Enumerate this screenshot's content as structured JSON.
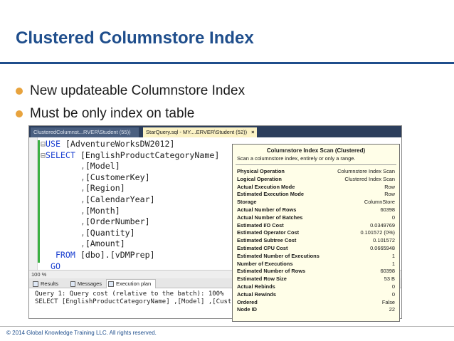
{
  "slide": {
    "title": "Clustered Columnstore Index",
    "bullets": [
      "New updateable Columnstore Index",
      "Must be only index on table"
    ],
    "footer": "© 2014 Global Knowledge Training LLC. All rights reserved."
  },
  "ssms": {
    "tabs": [
      "ClusteredColumnst...RVER\\Student (55))",
      "StarQuery.sql - MY....ERVER\\Student (52))"
    ],
    "tab_close": "×",
    "code": {
      "line1_kw": "USE",
      "line1_rest": " [AdventureWorksDW2012]",
      "line2_kw": "SELECT",
      "line2_rest": " [EnglishProductCategoryName]",
      "columns": [
        "[Model]",
        "[CustomerKey]",
        "[Region]",
        "[CalendarYear]",
        "[Month]",
        "[OrderNumber]",
        "[Quantity]",
        "[Amount]"
      ],
      "from_kw": "FROM",
      "from_rest": " [dbo].[vDMPrep]",
      "go_kw": "GO"
    },
    "zoom": "100 %",
    "result_tabs": [
      "Results",
      "Messages",
      "Execution plan"
    ],
    "query_lines": [
      "Query 1: Query cost (relative to the batch): 100%",
      "SELECT [EnglishProductCategoryName] ,[Model] ,[Custo"
    ]
  },
  "tooltip": {
    "title": "Columnstore Index Scan (Clustered)",
    "description": "Scan a columnstore index, entirely or only a range.",
    "rows": [
      {
        "k": "Physical Operation",
        "v": "Columnstore Index Scan"
      },
      {
        "k": "Logical Operation",
        "v": "Clustered Index Scan"
      },
      {
        "k": "Actual Execution Mode",
        "v": "Row"
      },
      {
        "k": "Estimated Execution Mode",
        "v": "Row"
      },
      {
        "k": "Storage",
        "v": "ColumnStore"
      },
      {
        "k": "Actual Number of Rows",
        "v": "60398"
      },
      {
        "k": "Actual Number of Batches",
        "v": "0"
      },
      {
        "k": "Estimated I/O Cost",
        "v": "0.0349769"
      },
      {
        "k": "Estimated Operator Cost",
        "v": "0.101572 (0%)"
      },
      {
        "k": "Estimated Subtree Cost",
        "v": "0.101572"
      },
      {
        "k": "Estimated CPU Cost",
        "v": "0.0665948"
      },
      {
        "k": "Estimated Number of Executions",
        "v": "1"
      },
      {
        "k": "Number of Executions",
        "v": "1"
      },
      {
        "k": "Estimated Number of Rows",
        "v": "60398"
      },
      {
        "k": "Estimated Row Size",
        "v": "53 B"
      },
      {
        "k": "Actual Rebinds",
        "v": "0"
      },
      {
        "k": "Actual Rewinds",
        "v": "0"
      },
      {
        "k": "Ordered",
        "v": "False"
      },
      {
        "k": "Node ID",
        "v": "22"
      }
    ]
  }
}
